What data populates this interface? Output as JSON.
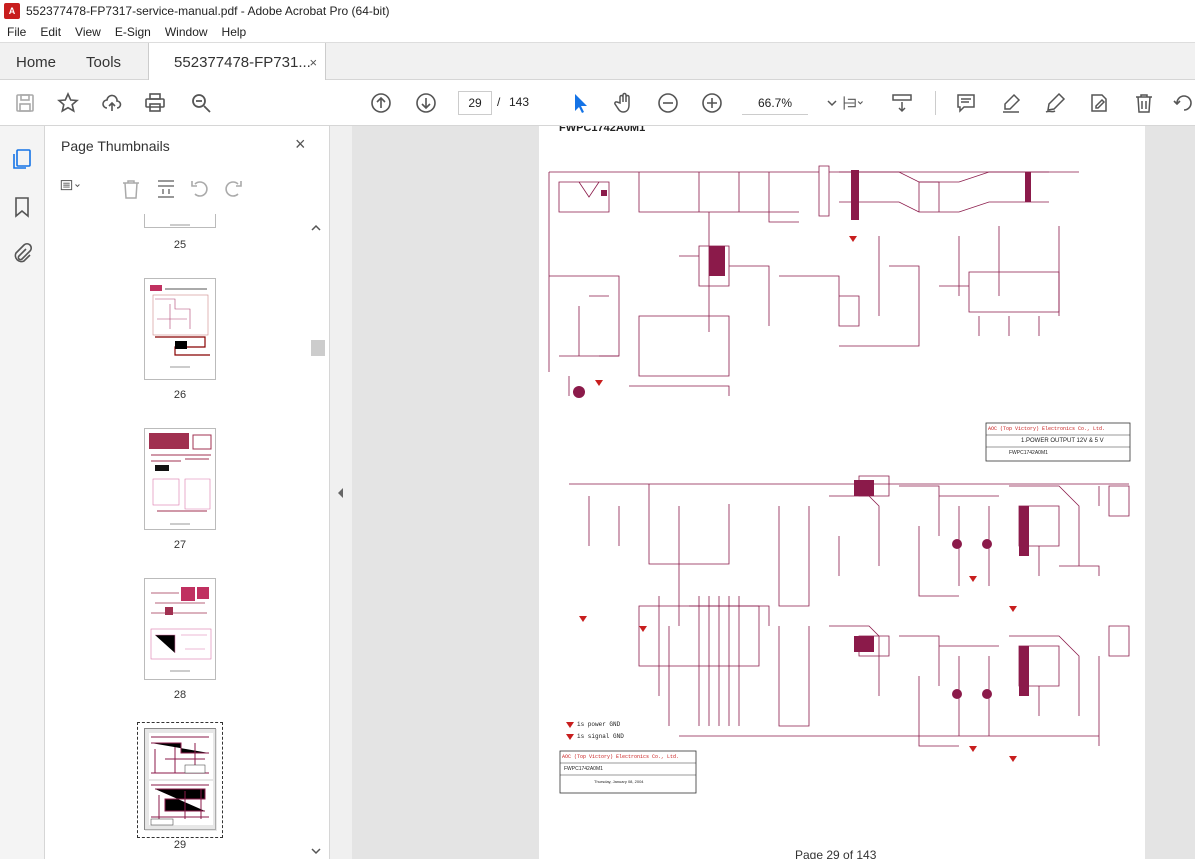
{
  "window": {
    "title": "552377478-FP7317-service-manual.pdf - Adobe Acrobat Pro (64-bit)"
  },
  "menu": [
    "File",
    "Edit",
    "View",
    "E-Sign",
    "Window",
    "Help"
  ],
  "tabs": {
    "home": "Home",
    "tools": "Tools",
    "document": "552377478-FP731...",
    "close": "×"
  },
  "toolbar": {
    "current_page": "29",
    "page_sep": "/",
    "total_pages": "143",
    "zoom": "66.7%"
  },
  "thumbnails_panel": {
    "title": "Page Thumbnails",
    "close": "×",
    "pages": [
      "25",
      "26",
      "27",
      "28",
      "29"
    ],
    "selected": "29"
  },
  "document": {
    "page_footer": "Page 29 of 143",
    "header_text": "FWPC1742A0M1",
    "title_block_1": {
      "company": "AOC (Top Victory) Electronics Co., Ltd.",
      "title": "1.POWER OUTPUT 12V & 5 V",
      "model": "FWPC1742A0M1"
    },
    "title_block_2": {
      "company": "AOC (Top Victory) Electronics Co., Ltd.",
      "model": "FWPC1742A0M1",
      "date": "Thursday, January 08, 2004"
    },
    "legend": [
      "is power GND",
      "is signal GND"
    ]
  },
  "colors": {
    "schematic": "#8b1a4a",
    "accent": "#c81e1e"
  }
}
